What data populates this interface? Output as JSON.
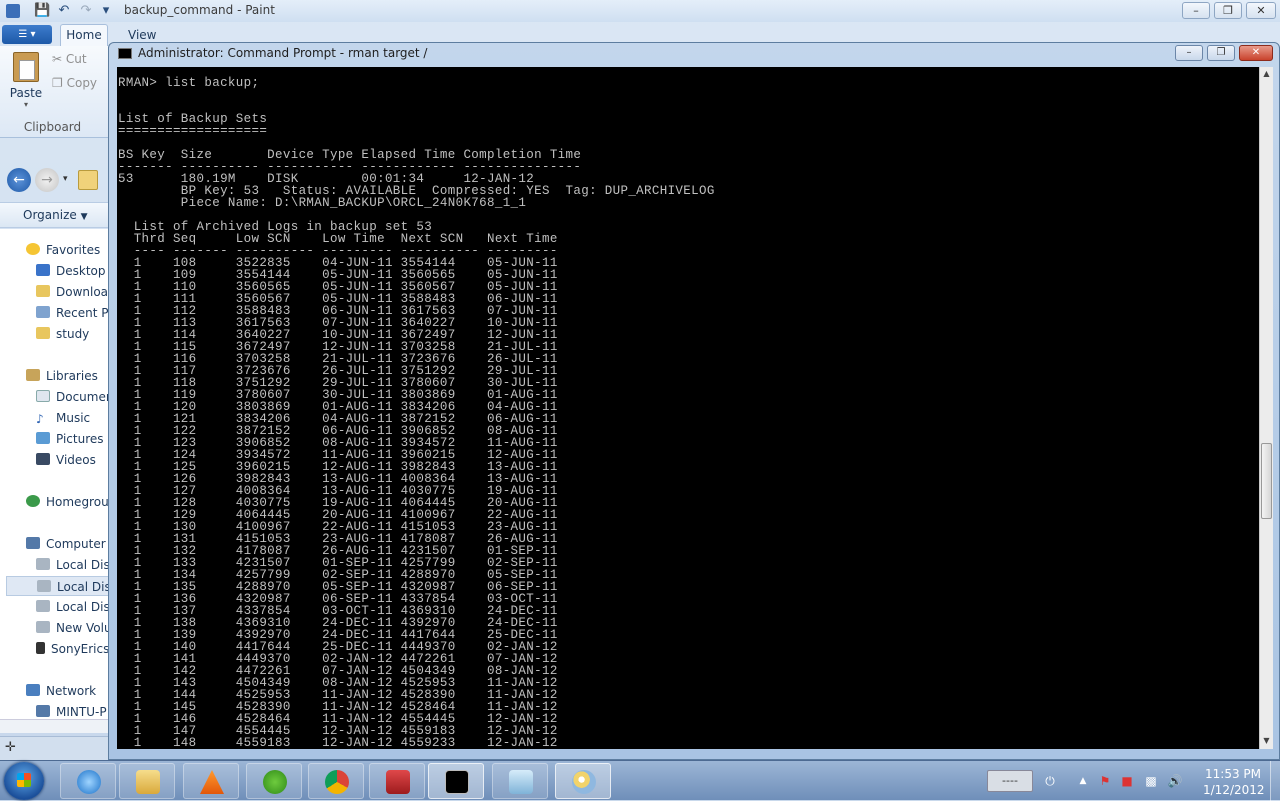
{
  "paint": {
    "title": "backup_command - Paint",
    "qa_icons": [
      "save-icon",
      "undo-icon",
      "redo-icon",
      "dropdown-icon"
    ],
    "tabs": {
      "home": "Home",
      "view": "View"
    },
    "ribbon": {
      "paste": "Paste",
      "cut": "Cut",
      "copy": "Copy",
      "group_clipboard": "Clipboard"
    },
    "organize": "Organize",
    "nav": {
      "favorites": "Favorites",
      "desktop": "Desktop",
      "downloads": "Download",
      "recent": "Recent Pl",
      "study": "study",
      "libraries": "Libraries",
      "documents": "Documen",
      "music": "Music",
      "pictures": "Pictures",
      "videos": "Videos",
      "homegroup": "Homegroup",
      "computer": "Computer",
      "disk1": "Local Disk",
      "disk2": "Local Disk",
      "disk3": "Local Disk",
      "new_volume": "New Volu",
      "sony": "SonyErics",
      "network": "Network",
      "mintu": "MINTU-P"
    }
  },
  "cmd": {
    "title": "Administrator: Command Prompt - rman  target /",
    "console_text": "RMAN> list backup;\n\n\nList of Backup Sets\n===================\n\nBS Key  Size       Device Type Elapsed Time Completion Time\n------- ---------- ----------- ------------ ---------------\n53      180.19M    DISK        00:01:34     12-JAN-12\n        BP Key: 53   Status: AVAILABLE  Compressed: YES  Tag: DUP_ARCHIVELOG\n        Piece Name: D:\\RMAN_BACKUP\\ORCL_24N0K768_1_1\n\n  List of Archived Logs in backup set 53\n  Thrd Seq     Low SCN    Low Time  Next SCN   Next Time\n  ---- ------- ---------- --------- ---------- ---------\n  1    108     3522835    04-JUN-11 3554144    05-JUN-11\n  1    109     3554144    05-JUN-11 3560565    05-JUN-11\n  1    110     3560565    05-JUN-11 3560567    05-JUN-11\n  1    111     3560567    05-JUN-11 3588483    06-JUN-11\n  1    112     3588483    06-JUN-11 3617563    07-JUN-11\n  1    113     3617563    07-JUN-11 3640227    10-JUN-11\n  1    114     3640227    10-JUN-11 3672497    12-JUN-11\n  1    115     3672497    12-JUN-11 3703258    21-JUL-11\n  1    116     3703258    21-JUL-11 3723676    26-JUL-11\n  1    117     3723676    26-JUL-11 3751292    29-JUL-11\n  1    118     3751292    29-JUL-11 3780607    30-JUL-11\n  1    119     3780607    30-JUL-11 3803869    01-AUG-11\n  1    120     3803869    01-AUG-11 3834206    04-AUG-11\n  1    121     3834206    04-AUG-11 3872152    06-AUG-11\n  1    122     3872152    06-AUG-11 3906852    08-AUG-11\n  1    123     3906852    08-AUG-11 3934572    11-AUG-11\n  1    124     3934572    11-AUG-11 3960215    12-AUG-11\n  1    125     3960215    12-AUG-11 3982843    13-AUG-11\n  1    126     3982843    13-AUG-11 4008364    13-AUG-11\n  1    127     4008364    13-AUG-11 4030775    19-AUG-11\n  1    128     4030775    19-AUG-11 4064445    20-AUG-11\n  1    129     4064445    20-AUG-11 4100967    22-AUG-11\n  1    130     4100967    22-AUG-11 4151053    23-AUG-11\n  1    131     4151053    23-AUG-11 4178087    26-AUG-11\n  1    132     4178087    26-AUG-11 4231507    01-SEP-11\n  1    133     4231507    01-SEP-11 4257799    02-SEP-11\n  1    134     4257799    02-SEP-11 4288970    05-SEP-11\n  1    135     4288970    05-SEP-11 4320987    06-SEP-11\n  1    136     4320987    06-SEP-11 4337854    03-OCT-11\n  1    137     4337854    03-OCT-11 4369310    24-DEC-11\n  1    138     4369310    24-DEC-11 4392970    24-DEC-11\n  1    139     4392970    24-DEC-11 4417644    25-DEC-11\n  1    140     4417644    25-DEC-11 4449370    02-JAN-12\n  1    141     4449370    02-JAN-12 4472261    07-JAN-12\n  1    142     4472261    07-JAN-12 4504349    08-JAN-12\n  1    143     4504349    08-JAN-12 4525953    11-JAN-12\n  1    144     4525953    11-JAN-12 4528390    11-JAN-12\n  1    145     4528390    11-JAN-12 4528464    11-JAN-12\n  1    146     4528464    11-JAN-12 4554445    12-JAN-12\n  1    147     4554445    12-JAN-12 4559183    12-JAN-12\n  1    148     4559183    12-JAN-12 4559233    12-JAN-12"
  },
  "taskbar": {
    "apps": [
      "internet-explorer-icon",
      "file-explorer-icon",
      "vlc-icon",
      "utorrent-icon",
      "chrome-icon",
      "toolbox-icon",
      "command-prompt-icon",
      "notepad-icon",
      "paint-icon"
    ],
    "tray_input": "----",
    "time": "11:53 PM",
    "date": "1/12/2012"
  }
}
